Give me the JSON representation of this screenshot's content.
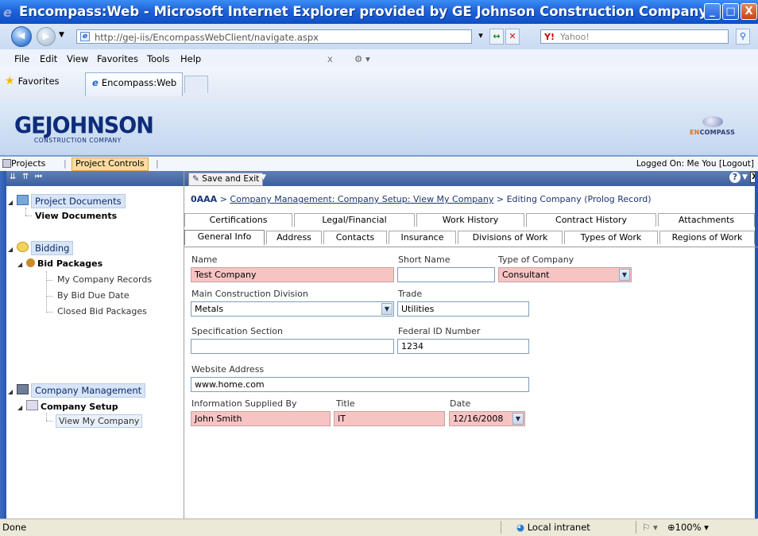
{
  "window": {
    "title": "Encompass:Web - Microsoft Internet Explorer provided by GE Johnson Construction Company"
  },
  "browser": {
    "url": "http://gej-iis/EncompassWebClient/navigate.aspx",
    "search_placeholder": "Yahoo!",
    "menu": [
      "File",
      "Edit",
      "View",
      "Favorites",
      "Tools",
      "Help"
    ],
    "favorites_label": "Favorites",
    "tab_title": "Encompass:Web"
  },
  "app": {
    "logo_main": "GEJOHNSON",
    "logo_sub": "CONSTRUCTION COMPANY",
    "brand": "ENCOMPASS",
    "module_tabs": [
      "Projects",
      "Project Controls"
    ],
    "logged_on": "Logged On: Me You",
    "logout": "[Logout]"
  },
  "sidebar": {
    "project_documents": "Project Documents",
    "view_documents": "View Documents",
    "bidding": "Bidding",
    "bid_packages": "Bid Packages",
    "bid_items": [
      "My Company Records",
      "By Bid Due Date",
      "Closed Bid Packages"
    ],
    "company_management": "Company Management",
    "company_setup": "Company Setup",
    "view_my_company": "View My Company"
  },
  "toolbar": {
    "save_exit": "Save and Exit"
  },
  "breadcrumb": {
    "root": "0AAA",
    "link": "Company Management: Company Setup: View My Company",
    "current": "Editing Company (Prolog Record)"
  },
  "tabs_top": [
    "Certifications",
    "Legal/Financial",
    "Work History",
    "Contract History",
    "Attachments"
  ],
  "tabs_bottom": [
    "General Info",
    "Address",
    "Contacts",
    "Insurance",
    "Divisions of Work",
    "Types of Work",
    "Regions of Work"
  ],
  "form": {
    "name_label": "Name",
    "name_value": "Test Company",
    "short_name_label": "Short Name",
    "short_name_value": "",
    "type_label": "Type of Company",
    "type_value": "Consultant",
    "division_label": "Main Construction Division",
    "division_value": "Metals",
    "trade_label": "Trade",
    "trade_value": "Utilities",
    "spec_label": "Specification Section",
    "spec_value": "",
    "fedid_label": "Federal ID Number",
    "fedid_value": "1234",
    "website_label": "Website Address",
    "website_value": "www.home.com",
    "supplied_label": "Information Supplied By",
    "supplied_value": "John Smith",
    "title_label": "Title",
    "title_value": "IT",
    "date_label": "Date",
    "date_value": "12/16/2008"
  },
  "status": {
    "left": "Done",
    "zone": "Local intranet",
    "zoom": "100%"
  },
  "colors": {
    "required_field": "#f7c4c4",
    "titlebar": "#1f63d8",
    "nav_bar": "#3c5f9e"
  }
}
